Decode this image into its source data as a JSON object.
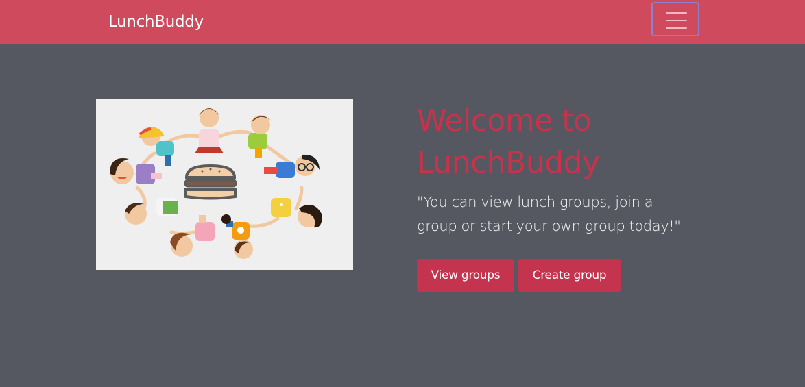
{
  "navbar": {
    "brand": "LunchBuddy",
    "toggler_icon": "hamburger-menu-icon"
  },
  "hero": {
    "image": {
      "description_icon": "kids-circle-burger-illustration"
    },
    "title_line1": "Welcome to",
    "title_line2": "LunchBuddy",
    "lead_line1": "\"You can view lunch groups, join a",
    "lead_line2": "group or start your own group today!\"",
    "buttons": {
      "view_groups": "View groups",
      "create_group": "Create group"
    }
  },
  "colors": {
    "navbar_bg": "#cf4a5d",
    "page_bg": "#555761",
    "accent": "#c4344e",
    "title": "#c8324b"
  }
}
